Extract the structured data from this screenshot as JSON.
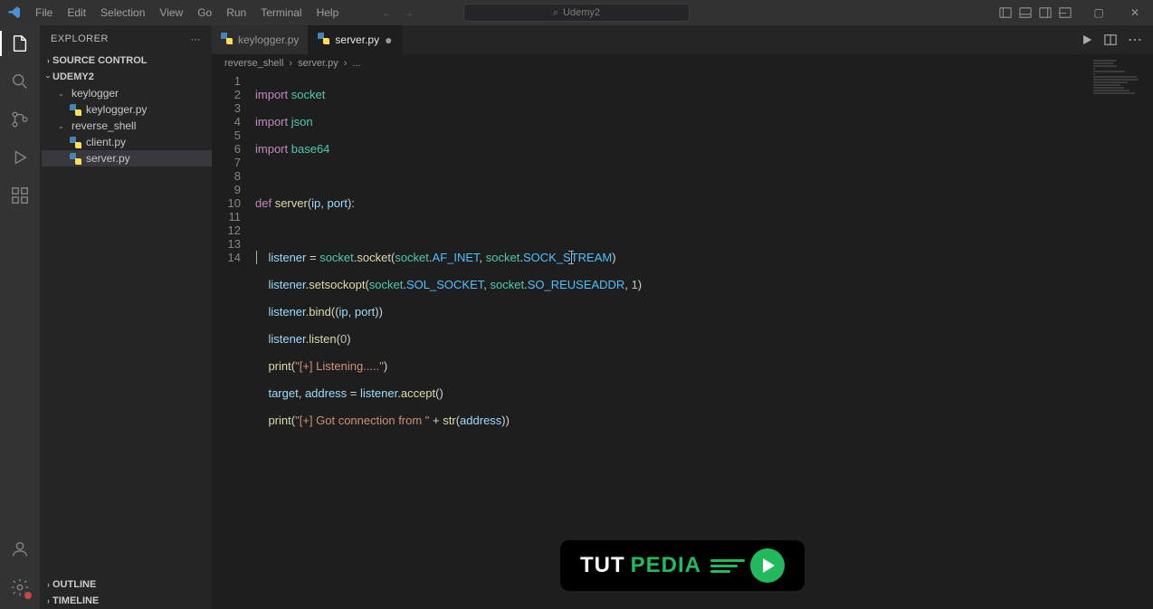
{
  "window": {
    "title": "Udemy2"
  },
  "menu": {
    "file": "File",
    "edit": "Edit",
    "selection": "Selection",
    "view": "View",
    "go": "Go",
    "run": "Run",
    "terminal": "Terminal",
    "help": "Help"
  },
  "sidebar": {
    "header": "EXPLORER",
    "sections": {
      "source_control": "SOURCE CONTROL",
      "project": "UDEMY2",
      "outline": "OUTLINE",
      "timeline": "TIMELINE"
    },
    "tree": {
      "folder1": "keylogger",
      "file1": "keylogger.py",
      "folder2": "reverse_shell",
      "file2": "client.py",
      "file3": "server.py"
    }
  },
  "tabs": {
    "t1": "keylogger.py",
    "t2": "server.py"
  },
  "breadcrumbs": {
    "b1": "reverse_shell",
    "b2": "server.py",
    "b3": "..."
  },
  "code": {
    "lines": [
      1,
      2,
      3,
      4,
      5,
      6,
      7,
      8,
      9,
      10,
      11,
      12,
      13,
      14
    ],
    "l1": {
      "kw": "import",
      "mod": "socket"
    },
    "l2": {
      "kw": "import",
      "mod": "json"
    },
    "l3": {
      "kw": "import",
      "mod": "base64"
    },
    "l5": {
      "kw": "def",
      "fn": "server",
      "p1": "ip",
      "p2": "port"
    },
    "l7": {
      "v": "listener",
      "m": "socket",
      "f": "socket",
      "a1": "socket",
      "c1": "AF_INET",
      "a2": "socket",
      "c2": "SOCK_STREAM"
    },
    "l8": {
      "v": "listener",
      "f": "setsockopt",
      "a1": "socket",
      "c1": "SOL_SOCKET",
      "a2": "socket",
      "c2": "SO_REUSEADDR",
      "n": "1"
    },
    "l9": {
      "v": "listener",
      "f": "bind",
      "p1": "ip",
      "p2": "port"
    },
    "l10": {
      "v": "listener",
      "f": "listen",
      "n": "0"
    },
    "l11": {
      "f": "print",
      "s": "\"[+] Listening.....\""
    },
    "l12": {
      "v1": "target",
      "v2": "address",
      "v3": "listener",
      "f": "accept"
    },
    "l13": {
      "f": "print",
      "s": "\"[+] Got connection from \"",
      "f2": "str",
      "v": "address"
    }
  },
  "watermark": {
    "t1": "TUT",
    "t2": "PEDIA"
  }
}
